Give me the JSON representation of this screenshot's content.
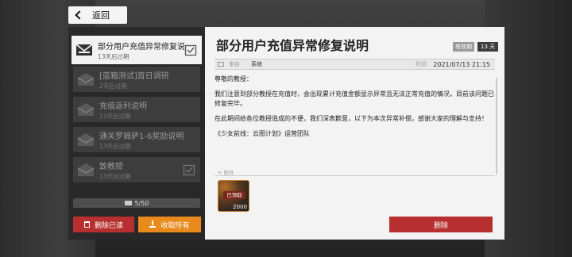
{
  "nav": {
    "back_label": "返回"
  },
  "mail_list": [
    {
      "title": "部分用户充值异常修复说明",
      "expiry": "13天后过期",
      "active": true,
      "has_attachment": true
    },
    {
      "title": "[蓝箱测试]首日调研",
      "expiry": "2天后过期",
      "active": false,
      "has_attachment": false
    },
    {
      "title": "充值返利说明",
      "expiry": "13天后过期",
      "active": false,
      "has_attachment": false
    },
    {
      "title": "通关罗姆萨1-6奖励说明",
      "expiry": "13天后过期",
      "active": false,
      "has_attachment": false
    },
    {
      "title": "致教授",
      "expiry": "13天后过期",
      "active": false,
      "has_attachment": true
    }
  ],
  "mail_count": "5/50",
  "buttons": {
    "delete_read": "删除已读",
    "receive_all": "收取所有",
    "delete": "删除"
  },
  "mail": {
    "title": "部分用户充值异常修复说明",
    "validity_label": "有效期",
    "validity_days": "13 天",
    "from_label": "来自",
    "from": "系统",
    "time_label": "时间",
    "time": "2021/07/13 21:15",
    "greeting": "尊敬的教授：",
    "para1": "我们注意到部分教授在充值时，会出现累计充值金额显示异常且无法正常充值的情况，目前该问题已修复完毕。",
    "para2": "在此期间给各位教授造成的不便，我们深表歉意，以下为本次异常补偿，感谢大家的理解与支持！",
    "signature": "《少女前线：云图计划》运营团队",
    "attachment_label": "附件",
    "attachment": {
      "stamp": "已领取",
      "quantity": "2000"
    }
  },
  "colors": {
    "accent_red": "#b72f2f",
    "accent_orange": "#e88a1c",
    "panel_light": "#f3f3f3",
    "panel_dark": "#282828"
  }
}
